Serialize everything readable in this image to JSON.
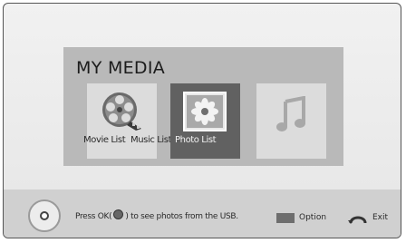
{
  "panel": {
    "title": "MY MEDIA"
  },
  "tiles": [
    {
      "label": "Movie List",
      "icon": "film-reel-icon",
      "selected": false
    },
    {
      "label": "Music List",
      "icon": "music-note-icon",
      "selected": false
    },
    {
      "label": "Photo List",
      "icon": "flower-photo-icon",
      "selected": true
    },
    {
      "label": "",
      "icon": "music-note-icon",
      "selected": false
    }
  ],
  "bottombar": {
    "hint_before": "Press OK(",
    "hint_after": ") to see photos from the USB.",
    "option_label": "Option",
    "exit_label": "Exit"
  }
}
